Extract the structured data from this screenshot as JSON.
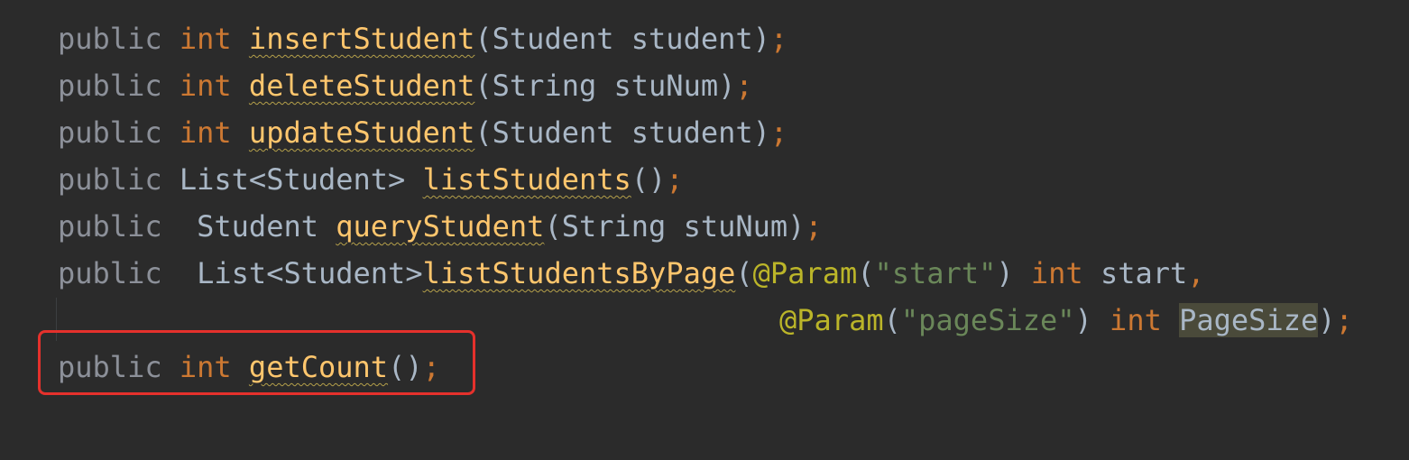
{
  "code": {
    "line1": {
      "modifier": "public",
      "return_type": "int",
      "method": "insertStudent",
      "open": "(",
      "params": "Student student",
      "close": ")",
      "end": ";"
    },
    "line2": {
      "modifier": "public",
      "return_type": "int",
      "method": "deleteStudent",
      "open": "(",
      "params": "String stuNum",
      "close": ")",
      "end": ";"
    },
    "line3": {
      "modifier": "public",
      "return_type": "int",
      "method": "updateStudent",
      "open": "(",
      "params": "Student student",
      "close": ")",
      "end": ";"
    },
    "line4": {
      "modifier": "public",
      "return_type": "List<Student>",
      "method": "listStudents",
      "parens": "()",
      "end": ";"
    },
    "line5": {
      "modifier": "public",
      "return_type": "Student",
      "method": "queryStudent",
      "open": "(",
      "params": "String stuNum",
      "close": ")",
      "end": ";"
    },
    "line6": {
      "modifier": "public",
      "return_type": "List<Student>",
      "method": "listStudentsByPage",
      "open": "(",
      "annotation": "@Param",
      "annot_open": "(",
      "annot_value": "\"start\"",
      "annot_close": ")",
      "param_type": "int",
      "param_name": "start",
      "comma": ","
    },
    "line7": {
      "annotation": "@Param",
      "annot_open": "(",
      "annot_value": "\"pageSize\"",
      "annot_close": ")",
      "param_type": "int",
      "param_name": "PageSize",
      "close": ")",
      "end": ";"
    },
    "line8": {
      "modifier": "public",
      "return_type": "int",
      "method": "getCount",
      "parens": "()",
      "end": ";"
    }
  },
  "colors": {
    "background": "#2b2b2b",
    "keyword": "#cc7832",
    "method": "#ffc66d",
    "annotation": "#bbb529",
    "string": "#6a8759",
    "highlight_box": "#e5312c"
  }
}
